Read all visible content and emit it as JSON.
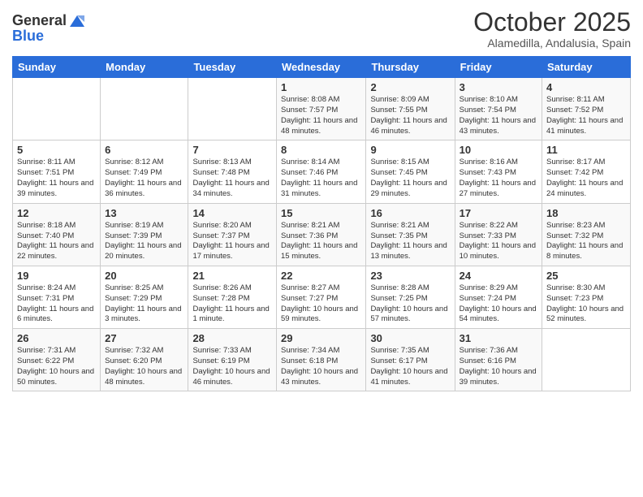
{
  "logo": {
    "general": "General",
    "blue": "Blue"
  },
  "header": {
    "month": "October 2025",
    "location": "Alamedilla, Andalusia, Spain"
  },
  "days_of_week": [
    "Sunday",
    "Monday",
    "Tuesday",
    "Wednesday",
    "Thursday",
    "Friday",
    "Saturday"
  ],
  "weeks": [
    [
      {
        "day": "",
        "info": ""
      },
      {
        "day": "",
        "info": ""
      },
      {
        "day": "",
        "info": ""
      },
      {
        "day": "1",
        "info": "Sunrise: 8:08 AM\nSunset: 7:57 PM\nDaylight: 11 hours and 48 minutes."
      },
      {
        "day": "2",
        "info": "Sunrise: 8:09 AM\nSunset: 7:55 PM\nDaylight: 11 hours and 46 minutes."
      },
      {
        "day": "3",
        "info": "Sunrise: 8:10 AM\nSunset: 7:54 PM\nDaylight: 11 hours and 43 minutes."
      },
      {
        "day": "4",
        "info": "Sunrise: 8:11 AM\nSunset: 7:52 PM\nDaylight: 11 hours and 41 minutes."
      }
    ],
    [
      {
        "day": "5",
        "info": "Sunrise: 8:11 AM\nSunset: 7:51 PM\nDaylight: 11 hours and 39 minutes."
      },
      {
        "day": "6",
        "info": "Sunrise: 8:12 AM\nSunset: 7:49 PM\nDaylight: 11 hours and 36 minutes."
      },
      {
        "day": "7",
        "info": "Sunrise: 8:13 AM\nSunset: 7:48 PM\nDaylight: 11 hours and 34 minutes."
      },
      {
        "day": "8",
        "info": "Sunrise: 8:14 AM\nSunset: 7:46 PM\nDaylight: 11 hours and 31 minutes."
      },
      {
        "day": "9",
        "info": "Sunrise: 8:15 AM\nSunset: 7:45 PM\nDaylight: 11 hours and 29 minutes."
      },
      {
        "day": "10",
        "info": "Sunrise: 8:16 AM\nSunset: 7:43 PM\nDaylight: 11 hours and 27 minutes."
      },
      {
        "day": "11",
        "info": "Sunrise: 8:17 AM\nSunset: 7:42 PM\nDaylight: 11 hours and 24 minutes."
      }
    ],
    [
      {
        "day": "12",
        "info": "Sunrise: 8:18 AM\nSunset: 7:40 PM\nDaylight: 11 hours and 22 minutes."
      },
      {
        "day": "13",
        "info": "Sunrise: 8:19 AM\nSunset: 7:39 PM\nDaylight: 11 hours and 20 minutes."
      },
      {
        "day": "14",
        "info": "Sunrise: 8:20 AM\nSunset: 7:37 PM\nDaylight: 11 hours and 17 minutes."
      },
      {
        "day": "15",
        "info": "Sunrise: 8:21 AM\nSunset: 7:36 PM\nDaylight: 11 hours and 15 minutes."
      },
      {
        "day": "16",
        "info": "Sunrise: 8:21 AM\nSunset: 7:35 PM\nDaylight: 11 hours and 13 minutes."
      },
      {
        "day": "17",
        "info": "Sunrise: 8:22 AM\nSunset: 7:33 PM\nDaylight: 11 hours and 10 minutes."
      },
      {
        "day": "18",
        "info": "Sunrise: 8:23 AM\nSunset: 7:32 PM\nDaylight: 11 hours and 8 minutes."
      }
    ],
    [
      {
        "day": "19",
        "info": "Sunrise: 8:24 AM\nSunset: 7:31 PM\nDaylight: 11 hours and 6 minutes."
      },
      {
        "day": "20",
        "info": "Sunrise: 8:25 AM\nSunset: 7:29 PM\nDaylight: 11 hours and 3 minutes."
      },
      {
        "day": "21",
        "info": "Sunrise: 8:26 AM\nSunset: 7:28 PM\nDaylight: 11 hours and 1 minute."
      },
      {
        "day": "22",
        "info": "Sunrise: 8:27 AM\nSunset: 7:27 PM\nDaylight: 10 hours and 59 minutes."
      },
      {
        "day": "23",
        "info": "Sunrise: 8:28 AM\nSunset: 7:25 PM\nDaylight: 10 hours and 57 minutes."
      },
      {
        "day": "24",
        "info": "Sunrise: 8:29 AM\nSunset: 7:24 PM\nDaylight: 10 hours and 54 minutes."
      },
      {
        "day": "25",
        "info": "Sunrise: 8:30 AM\nSunset: 7:23 PM\nDaylight: 10 hours and 52 minutes."
      }
    ],
    [
      {
        "day": "26",
        "info": "Sunrise: 7:31 AM\nSunset: 6:22 PM\nDaylight: 10 hours and 50 minutes."
      },
      {
        "day": "27",
        "info": "Sunrise: 7:32 AM\nSunset: 6:20 PM\nDaylight: 10 hours and 48 minutes."
      },
      {
        "day": "28",
        "info": "Sunrise: 7:33 AM\nSunset: 6:19 PM\nDaylight: 10 hours and 46 minutes."
      },
      {
        "day": "29",
        "info": "Sunrise: 7:34 AM\nSunset: 6:18 PM\nDaylight: 10 hours and 43 minutes."
      },
      {
        "day": "30",
        "info": "Sunrise: 7:35 AM\nSunset: 6:17 PM\nDaylight: 10 hours and 41 minutes."
      },
      {
        "day": "31",
        "info": "Sunrise: 7:36 AM\nSunset: 6:16 PM\nDaylight: 10 hours and 39 minutes."
      },
      {
        "day": "",
        "info": ""
      }
    ]
  ]
}
